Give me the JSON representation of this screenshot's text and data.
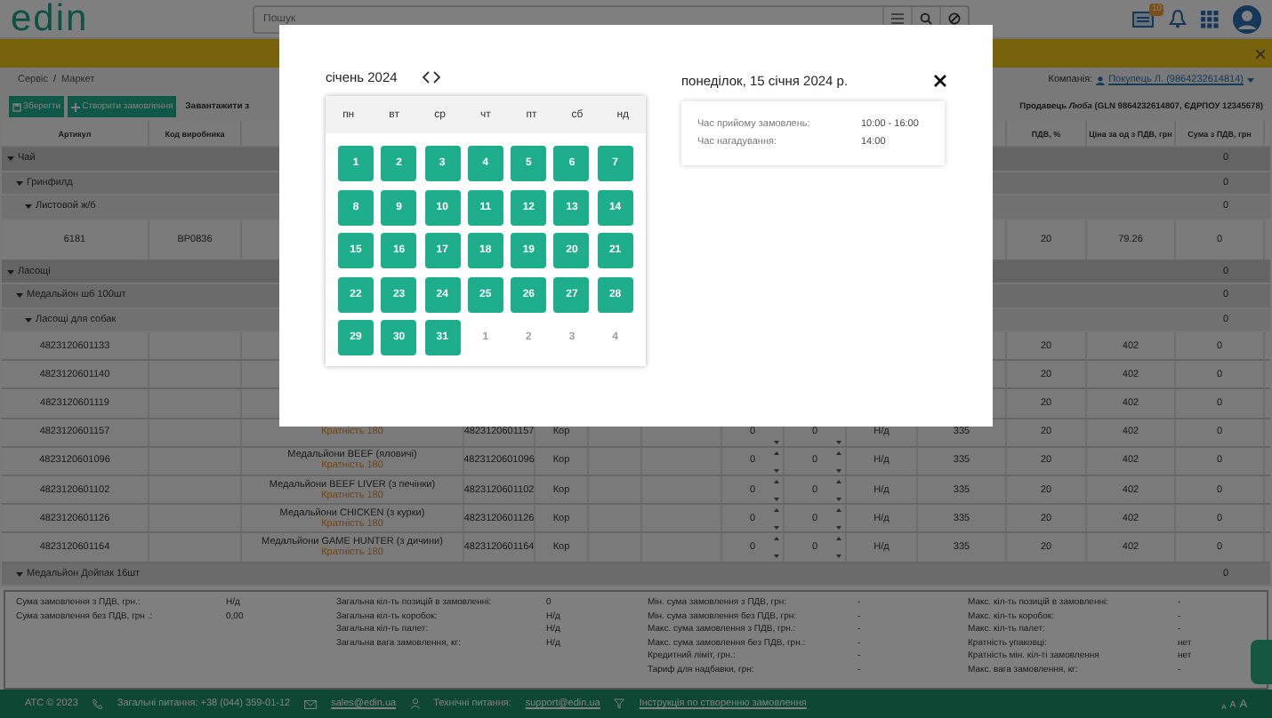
{
  "header": {
    "logo": "edin",
    "search": {
      "placeholder": "Пошук"
    },
    "badge": "10"
  },
  "breadcrumbs": {
    "items": [
      "Сервіс",
      "Маркет"
    ],
    "separator": "/"
  },
  "company": {
    "label": "Компанія:",
    "value": "Покупець Л. (9864232614814)"
  },
  "toolbar": {
    "buttons": [
      {
        "label": "Зберегти",
        "kind": "save"
      },
      {
        "label": "Створити замовлення",
        "kind": "create"
      }
    ],
    "upload": "Завантажити з",
    "seller": "Продавець *Люба* (GLN 9864232614807, ЄДРПОУ 12345678)"
  },
  "table": {
    "columns": [
      "Артикул",
      "Код виробника",
      "ПДВ, %",
      "Ціна за од з ПДВ, грн",
      "Сума з ПДВ, грн"
    ],
    "groups": [
      {
        "label": "Чай",
        "sum": "0",
        "expanded": true,
        "children": [
          {
            "label": "Гринфилд",
            "sum": "0",
            "expanded": true,
            "children": [
              {
                "label": "Листовой ж/б",
                "sum": "0",
                "expanded": true,
                "rows": [
                  {
                    "article": "6181",
                    "code": "BP0836",
                    "vat": "20",
                    "price": "79.26",
                    "sum": "0"
                  }
                ]
              }
            ]
          }
        ]
      },
      {
        "label": "Ласощі",
        "sum": "0",
        "expanded": true,
        "children": [
          {
            "label": "Медальйон шб 100шт",
            "sum": "0",
            "expanded": true,
            "children": [
              {
                "label": "Ласощі для собак",
                "sum": "0",
                "expanded": true,
                "rows": [
                  {
                    "article": "4823120601133",
                    "vat": "20",
                    "price": "402",
                    "sum": "0"
                  },
                  {
                    "article": "4823120601140",
                    "vat": "20",
                    "price": "402",
                    "sum": "0"
                  },
                  {
                    "article": "4823120601119",
                    "vat": "20",
                    "price": "402",
                    "sum": "0"
                  },
                  {
                    "article": "4823120601157",
                    "note": "Кратність 180",
                    "barcode": "4823120601157",
                    "unit": "Кор",
                    "qty": "0",
                    "qty2": "0",
                    "na": "Н/д",
                    "base": "335",
                    "vat": "20",
                    "price": "402",
                    "sum": "0"
                  },
                  {
                    "article": "4823120601096",
                    "name": "Медальйони BEEF (яловичі)",
                    "note": "Кратність 180",
                    "barcode": "4823120601096",
                    "unit": "Кор",
                    "qty": "0",
                    "qty2": "0",
                    "na": "Н/д",
                    "base": "335",
                    "vat": "20",
                    "price": "402",
                    "sum": "0"
                  },
                  {
                    "article": "4823120601102",
                    "name": "Медальйони BEEF LIVER (з печінки)",
                    "note": "Кратність 180",
                    "barcode": "4823120601102",
                    "unit": "Кор",
                    "qty": "0",
                    "qty2": "0",
                    "na": "Н/д",
                    "base": "335",
                    "vat": "20",
                    "price": "402",
                    "sum": "0"
                  },
                  {
                    "article": "4823120601126",
                    "name": "Медальйони CHICKEN (з курки)",
                    "note": "Кратність 180",
                    "barcode": "4823120601126",
                    "unit": "Кор",
                    "qty": "0",
                    "qty2": "0",
                    "na": "Н/д",
                    "base": "335",
                    "vat": "20",
                    "price": "402",
                    "sum": "0"
                  },
                  {
                    "article": "4823120601164",
                    "name": "Медальйони GAME HUNTER (з дичини)",
                    "note": "Кратність 180",
                    "barcode": "4823120601164",
                    "unit": "Кор",
                    "qty": "0",
                    "qty2": "0",
                    "na": "Н/д",
                    "base": "335",
                    "vat": "20",
                    "price": "402",
                    "sum": "0"
                  }
                ]
              }
            ]
          },
          {
            "label": "Медальйон Дойпак 16шт",
            "sum": "0",
            "expanded": true
          }
        ]
      }
    ]
  },
  "summary": [
    [
      {
        "label": "Сума замовлення з ПДВ, грн.:",
        "value": "Н/д"
      },
      {
        "label": "Сума замовлення без ПДВ, грн .:",
        "value": "0,00"
      }
    ],
    [
      {
        "label": "Загальна кіл-ть позицій в замовленні:",
        "value": "0"
      },
      {
        "label": "Загальна кіл-ть коробок:",
        "value": "Н/д"
      },
      {
        "label": "Загальна кіл-ть палет:",
        "value": "Н/д"
      },
      {
        "label": "Загальна вага замовлення, кг:",
        "value": "Н/д"
      }
    ],
    [
      {
        "label": "Мін. сума замовлення з ПДВ, грн:",
        "value": "-"
      },
      {
        "label": "Мін. сума замовлення без ПДВ, грн:",
        "value": "-"
      },
      {
        "label": "Макс. сума замовлення з ПДВ, грн.:",
        "value": "-"
      },
      {
        "label": "Макс. сума замовлення без ПДВ, грн.:",
        "value": "-"
      },
      {
        "label": "Кредитний ліміт, грн.:",
        "value": "-"
      },
      {
        "label": "Тариф для надбавки, грн:",
        "value": "-"
      }
    ],
    [
      {
        "label": "Макс. кіл-ть позицій в замовленні:",
        "value": "-"
      },
      {
        "label": "Макс. кіл-ть коробок:",
        "value": "-"
      },
      {
        "label": "Макс. кіл-ть палет:",
        "value": "-"
      },
      {
        "label": "Кратність упаковці:",
        "value": "нет"
      },
      {
        "label": "Кратність мін. кіл-ті замовлення",
        "value": "нет"
      },
      {
        "label": "Макс. вага замовлення, кг:",
        "value": "-"
      }
    ]
  ],
  "footer": {
    "copyright": "АТС © 2023",
    "phone": "Загальні питання: +38 (044) 359-01-12",
    "sales": "sales@edin.ua",
    "tech_label": "Технічні питання:",
    "tech_mail": "support@edin.ua",
    "guide": "Інструкція по створенню замовлення",
    "font_sizes": [
      "A",
      "A",
      "A"
    ]
  },
  "modal": {
    "month": "січень 2024",
    "weekdays": [
      "пн",
      "вт",
      "ср",
      "чт",
      "пт",
      "сб",
      "нд"
    ],
    "days": [
      {
        "label": "1",
        "muted": false
      },
      {
        "label": "2",
        "muted": false
      },
      {
        "label": "3",
        "muted": false
      },
      {
        "label": "4",
        "muted": false
      },
      {
        "label": "5",
        "muted": false
      },
      {
        "label": "6",
        "muted": false
      },
      {
        "label": "7",
        "muted": false
      },
      {
        "label": "8",
        "muted": false
      },
      {
        "label": "9",
        "muted": false
      },
      {
        "label": "10",
        "muted": false
      },
      {
        "label": "11",
        "muted": false
      },
      {
        "label": "12",
        "muted": false
      },
      {
        "label": "13",
        "muted": false
      },
      {
        "label": "14",
        "muted": false
      },
      {
        "label": "15",
        "muted": false
      },
      {
        "label": "16",
        "muted": false
      },
      {
        "label": "17",
        "muted": false
      },
      {
        "label": "18",
        "muted": false
      },
      {
        "label": "19",
        "muted": false
      },
      {
        "label": "20",
        "muted": false
      },
      {
        "label": "21",
        "muted": false
      },
      {
        "label": "22",
        "muted": false
      },
      {
        "label": "23",
        "muted": false
      },
      {
        "label": "24",
        "muted": false
      },
      {
        "label": "25",
        "muted": false
      },
      {
        "label": "26",
        "muted": false
      },
      {
        "label": "27",
        "muted": false
      },
      {
        "label": "28",
        "muted": false
      },
      {
        "label": "29",
        "muted": false
      },
      {
        "label": "30",
        "muted": false
      },
      {
        "label": "31",
        "muted": false
      },
      {
        "label": "1",
        "muted": true
      },
      {
        "label": "2",
        "muted": true
      },
      {
        "label": "3",
        "muted": true
      },
      {
        "label": "4",
        "muted": true
      }
    ],
    "date_title": "понеділок, 15 січня 2024 р.",
    "info": [
      {
        "label": "Час прийому замовлень:",
        "value": "10:00 - 16:00"
      },
      {
        "label": "Час нагадування:",
        "value": "14:00"
      }
    ]
  }
}
